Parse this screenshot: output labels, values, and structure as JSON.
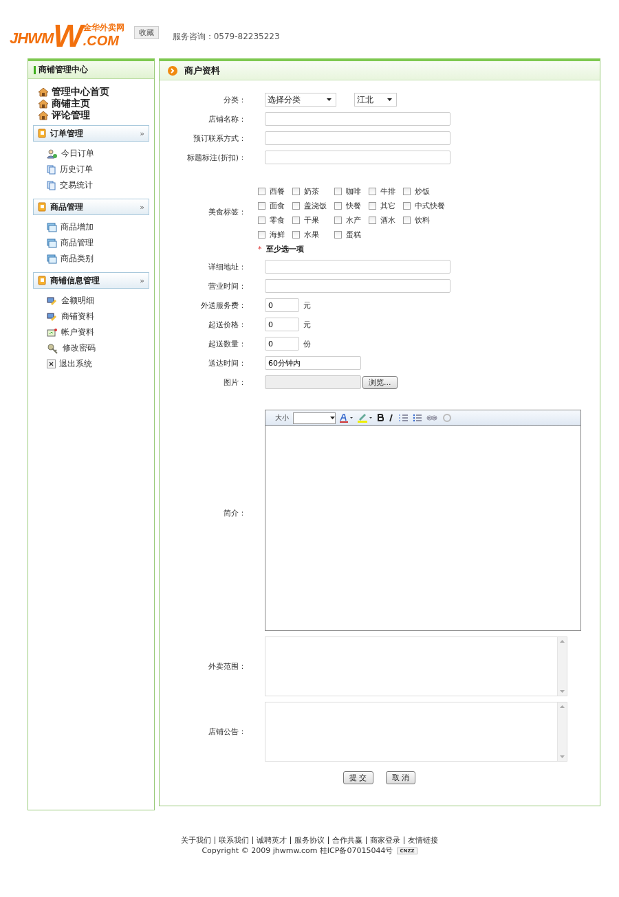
{
  "header": {
    "logo": {
      "text": "JHWM",
      "big": "W",
      "domain": ".COM",
      "cn": "金华外卖网"
    },
    "bookmark_button": "收藏",
    "hotline": "服务咨询：0579-82235223"
  },
  "sidebar": {
    "title": "商铺管理中心",
    "top_links": [
      {
        "label": "管理中心首页"
      },
      {
        "label": "商铺主页"
      },
      {
        "label": "评论管理"
      }
    ],
    "groups": [
      {
        "title": "订单管理",
        "arrow": "»",
        "items": [
          {
            "label": "今日订单",
            "kind": "user"
          },
          {
            "label": "历史订单",
            "kind": "doc"
          },
          {
            "label": "交易统计",
            "kind": "doc"
          }
        ]
      },
      {
        "title": "商品管理",
        "arrow": "»",
        "items": [
          {
            "label": "商品增加",
            "kind": "goods"
          },
          {
            "label": "商品管理",
            "kind": "goods"
          },
          {
            "label": "商品类别",
            "kind": "goods"
          }
        ]
      },
      {
        "title": "商铺信息管理",
        "arrow": "»",
        "items": [
          {
            "label": "金额明细",
            "kind": "card"
          },
          {
            "label": "商铺资料",
            "kind": "card"
          },
          {
            "label": "帐户资料",
            "kind": "note"
          },
          {
            "label": "修改密码",
            "kind": "key"
          },
          {
            "label": "退出系统",
            "kind": "close"
          }
        ]
      }
    ]
  },
  "panel": {
    "title": "商户资料",
    "rows": [
      {
        "kind": "selects",
        "label": "分类：",
        "selects": [
          "选择分类",
          "江北"
        ]
      },
      {
        "kind": "text",
        "label": "店铺名称："
      },
      {
        "kind": "text",
        "label": "预订联系方式："
      },
      {
        "kind": "text",
        "label": "标题标注(折扣)："
      },
      {
        "kind": "tags",
        "label": "美食标签：",
        "required_mark": "*",
        "hint": "至少选一项",
        "tags": [
          {
            "label": "西餐",
            "checked": false
          },
          {
            "label": "奶茶",
            "checked": false
          },
          {
            "label": "咖啡",
            "checked": false
          },
          {
            "label": "牛排",
            "checked": false
          },
          {
            "label": "炒饭",
            "checked": false
          },
          {
            "label": "面食",
            "checked": false
          },
          {
            "label": "盖浇饭",
            "checked": false
          },
          {
            "label": "快餐",
            "checked": false
          },
          {
            "label": "其它",
            "checked": false
          },
          {
            "label": "中式快餐",
            "checked": false
          },
          {
            "label": "零食",
            "checked": false
          },
          {
            "label": "干果",
            "checked": false
          },
          {
            "label": "水产",
            "checked": false
          },
          {
            "label": "酒水",
            "checked": false
          },
          {
            "label": "饮料",
            "checked": false
          },
          {
            "label": "海鲜",
            "checked": false
          },
          {
            "label": "水果",
            "checked": false
          },
          {
            "label": "蛋糕",
            "checked": false
          }
        ]
      },
      {
        "kind": "text",
        "label": "详细地址："
      },
      {
        "kind": "text",
        "label": "营业时间："
      },
      {
        "kind": "small",
        "label": "外送服务费：",
        "value": "0",
        "unit": "元"
      },
      {
        "kind": "small",
        "label": "起送价格：",
        "value": "0",
        "unit": "元"
      },
      {
        "kind": "small",
        "label": "起送数量：",
        "value": "0",
        "unit": "份"
      },
      {
        "kind": "medium",
        "label": "送达时间：",
        "value": "60分钟内"
      },
      {
        "kind": "file",
        "label": "图片：",
        "button": "浏览..."
      },
      {
        "kind": "editor",
        "label": "简介：",
        "size_label": "大小"
      },
      {
        "kind": "textarea",
        "label": "外卖范围："
      },
      {
        "kind": "textarea",
        "label": "店铺公告："
      }
    ],
    "buttons": [
      "提 交",
      "取 消"
    ]
  },
  "footer": {
    "links": [
      "关于我们",
      "联系我们",
      "诚聘英才",
      "服务协议",
      "合作共赢",
      "商家登录",
      "友情链接"
    ],
    "copyright": "Copyright © 2009 jhwmw.com 桂ICP备07015044号",
    "badge": "CNZZ"
  }
}
